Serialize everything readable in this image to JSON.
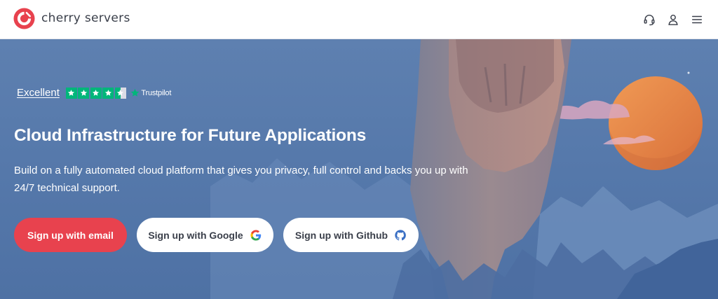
{
  "header": {
    "brand_name": "cherry servers",
    "actions": [
      {
        "name": "support",
        "icon": "headset-icon"
      },
      {
        "name": "account",
        "icon": "user-icon"
      },
      {
        "name": "menu",
        "icon": "hamburger-menu-icon"
      }
    ]
  },
  "hero": {
    "trustpilot": {
      "rating_text": "Excellent",
      "stars_filled": 4.5,
      "stars_total": 5,
      "brand": "Trustpilot"
    },
    "title": "Cloud Infrastructure for Future Applications",
    "subtitle": "Build on a fully automated cloud platform that gives you privacy, full control and backs you up with 24/7 technical support.",
    "buttons": {
      "email": "Sign up with email",
      "google": "Sign up with Google",
      "github": "Sign up with Github"
    }
  },
  "colors": {
    "brand_red": "#e8424e",
    "hero_blue": "#5679ab",
    "trustpilot_green": "#00b67a",
    "sun_orange": "#e8873f"
  }
}
